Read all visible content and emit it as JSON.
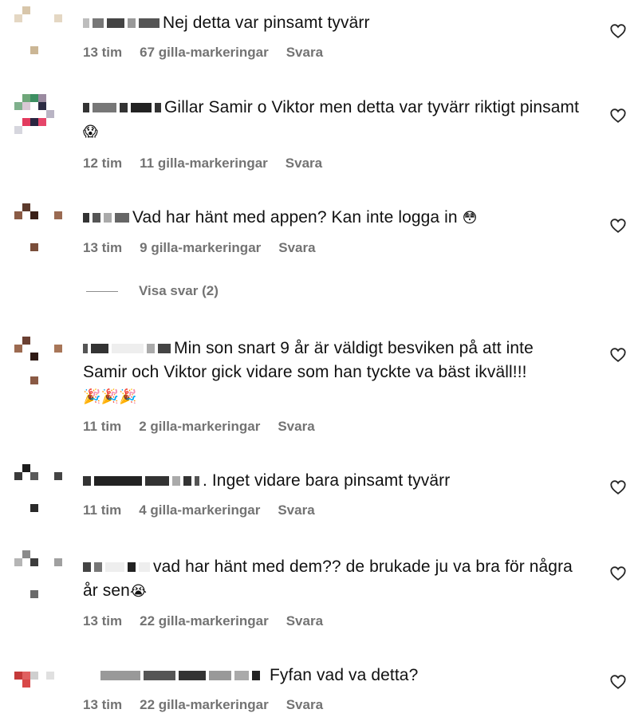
{
  "comments": [
    {
      "text": "Nej detta var pinsamt tyvärr",
      "time": "13 tim",
      "likes": "67 gilla-markeringar",
      "reply": "Svara"
    },
    {
      "text": "Gillar Samir o Viktor men detta var tyvärr riktigt pinsamt",
      "emoji": "😱",
      "time": "12 tim",
      "likes": "11 gilla-markeringar",
      "reply": "Svara"
    },
    {
      "text": "Vad har hänt med appen? Kan inte logga in",
      "emoji": "😳",
      "time": "13 tim",
      "likes": "9 gilla-markeringar",
      "reply": "Svara"
    },
    {
      "text": "Min son snart 9 år är väldigt besviken på att inte Samir och Viktor gick vidare som han tyckte va bäst ikväll!!!",
      "emoji": "🎉🎉🎉",
      "time": "11 tim",
      "likes": "2 gilla-markeringar",
      "reply": "Svara"
    },
    {
      "text": ". Inget vidare bara pinsamt tyvärr",
      "time": "11 tim",
      "likes": "4 gilla-markeringar",
      "reply": "Svara"
    },
    {
      "text": "vad har hänt med dem?? de brukade ju va bra för några år sen",
      "emoji": "😭",
      "time": "13 tim",
      "likes": "22 gilla-markeringar",
      "reply": "Svara"
    },
    {
      "text": "Fyfan vad va detta?",
      "time": "13 tim",
      "likes": "22 gilla-markeringar",
      "reply": "Svara"
    }
  ],
  "view_replies": "Visa svar (2)",
  "icons": {
    "like": "heart-outline-icon"
  },
  "colors": {
    "meta": "#737373",
    "text": "#111111",
    "heart": "#262626"
  }
}
